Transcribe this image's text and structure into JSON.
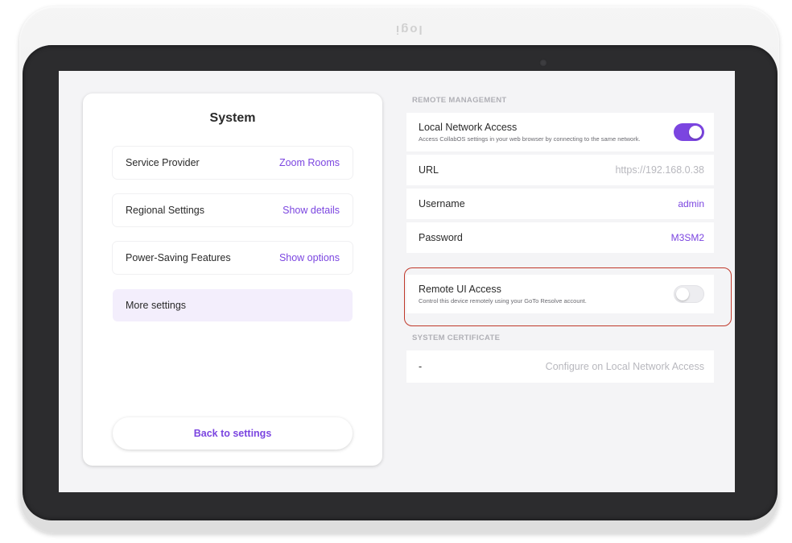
{
  "device": {
    "brand": "logi"
  },
  "left_panel": {
    "title": "System",
    "items": [
      {
        "label": "Service Provider",
        "value": "Zoom Rooms"
      },
      {
        "label": "Regional Settings",
        "value": "Show details"
      },
      {
        "label": "Power-Saving Features",
        "value": "Show options"
      },
      {
        "label": "More settings",
        "value": ""
      }
    ],
    "back_button": "Back to settings"
  },
  "remote_management": {
    "section_title": "REMOTE MANAGEMENT",
    "local_network_access": {
      "label": "Local Network Access",
      "description": "Access CollabOS settings in your web browser by connecting to the same network.",
      "enabled": true
    },
    "url": {
      "label": "URL",
      "value": "https://192.168.0.38"
    },
    "username": {
      "label": "Username",
      "value": "admin"
    },
    "password": {
      "label": "Password",
      "value": "M3SM2"
    },
    "remote_ui_access": {
      "label": "Remote UI Access",
      "description": "Control this device remotely using your GoTo Resolve account.",
      "enabled": false
    }
  },
  "system_certificate": {
    "section_title": "SYSTEM CERTIFICATE",
    "value": "-",
    "action": "Configure on Local Network Access"
  },
  "colors": {
    "accent": "#7b45e0",
    "highlight": "#c0392b",
    "active_row": "#f3eefc"
  }
}
